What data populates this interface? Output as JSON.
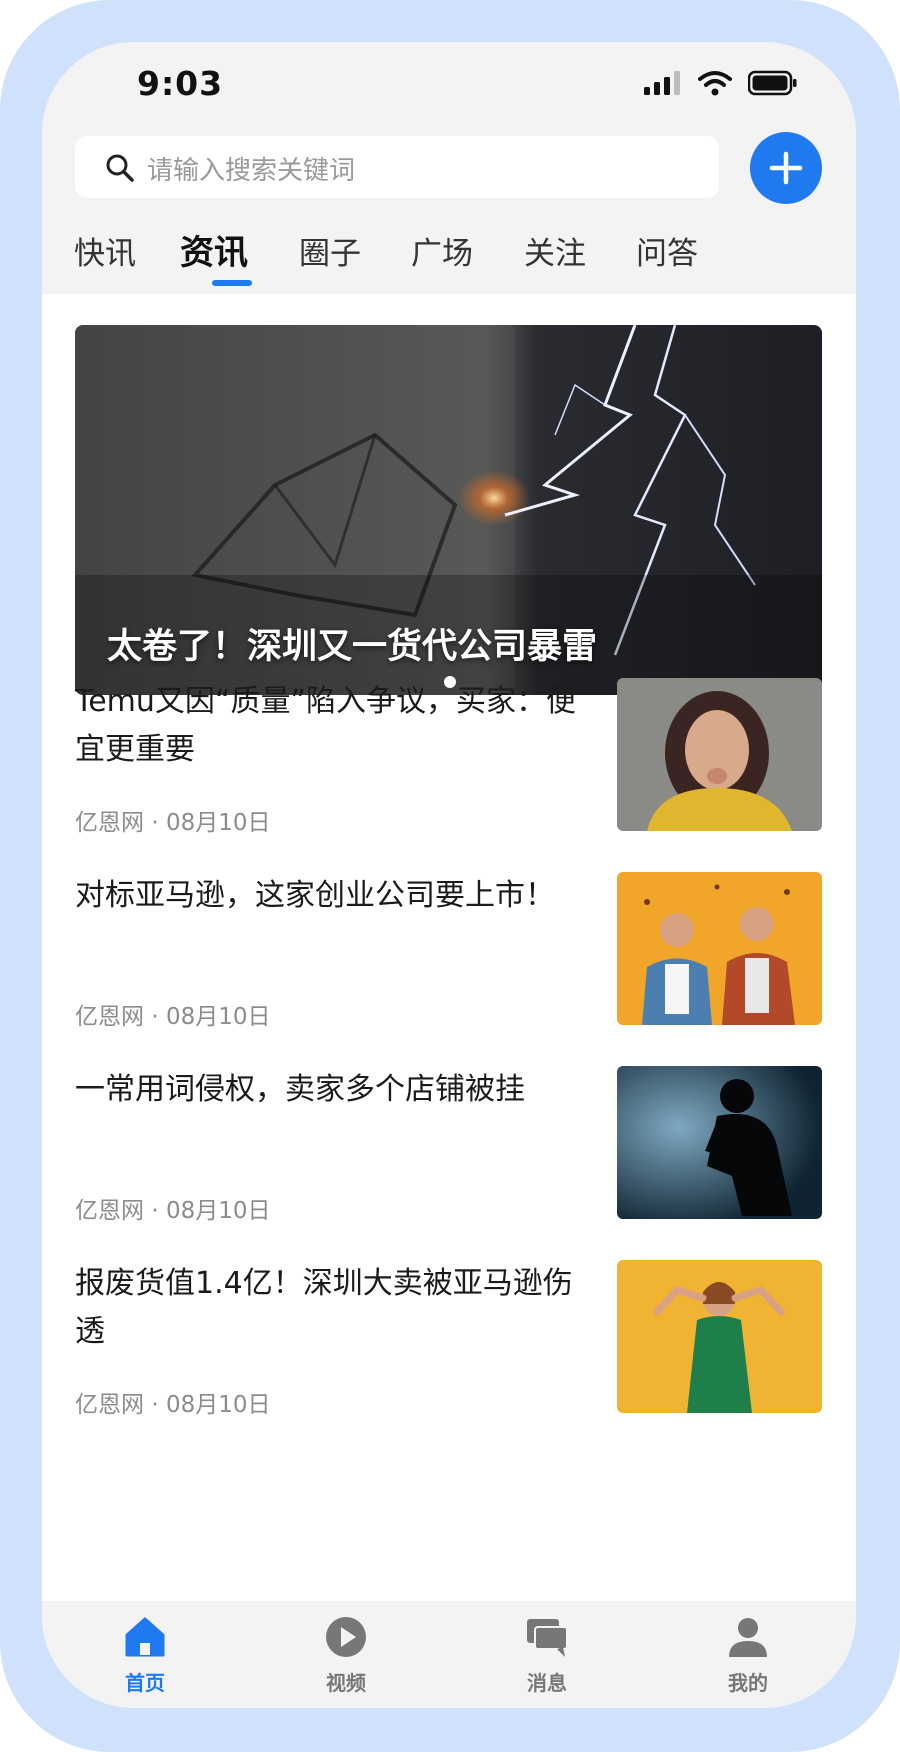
{
  "status_bar": {
    "time": "9:03",
    "icons": [
      "signal-icon",
      "wifi-icon",
      "battery-icon"
    ]
  },
  "search": {
    "placeholder": "请输入搜索关键词"
  },
  "add_button": {
    "icon": "plus-icon"
  },
  "tabs": [
    {
      "label": "快讯",
      "active": false
    },
    {
      "label": "资讯",
      "active": true
    },
    {
      "label": "圈子",
      "active": false
    },
    {
      "label": "广场",
      "active": false
    },
    {
      "label": "关注",
      "active": false
    },
    {
      "label": "问答",
      "active": false
    }
  ],
  "banner": {
    "title": "太卷了！深圳又一货代公司暴雷",
    "image": "cracked-wall-lightning-image"
  },
  "news": [
    {
      "title": "Temu又因“质量”陷入争议，买家：便宜更重要",
      "source": "亿恩网",
      "separator": "·",
      "date": "08月10日",
      "image": "shocked-woman-image"
    },
    {
      "title": "对标亚马逊，这家创业公司要上市！",
      "source": "亿恩网",
      "separator": "·",
      "date": "08月10日",
      "image": "excited-men-image"
    },
    {
      "title": "一常用词侵权，卖家多个店铺被挂",
      "source": "亿恩网",
      "separator": "·",
      "date": "08月10日",
      "image": "sad-silhouette-image"
    },
    {
      "title": "报废货值1.4亿！深圳大卖被亚马逊伤透",
      "source": "亿恩网",
      "separator": "·",
      "date": "08月10日",
      "image": "stressed-woman-image"
    }
  ],
  "bottom_nav": [
    {
      "label": "首页",
      "icon": "home-icon",
      "active": true
    },
    {
      "label": "视频",
      "icon": "play-icon",
      "active": false
    },
    {
      "label": "消息",
      "icon": "chat-icon",
      "active": false
    },
    {
      "label": "我的",
      "icon": "user-icon",
      "active": false
    }
  ],
  "colors": {
    "accent": "#1f7af0",
    "frame": "#cfe1fb",
    "header_bg": "#f3f3f3"
  }
}
